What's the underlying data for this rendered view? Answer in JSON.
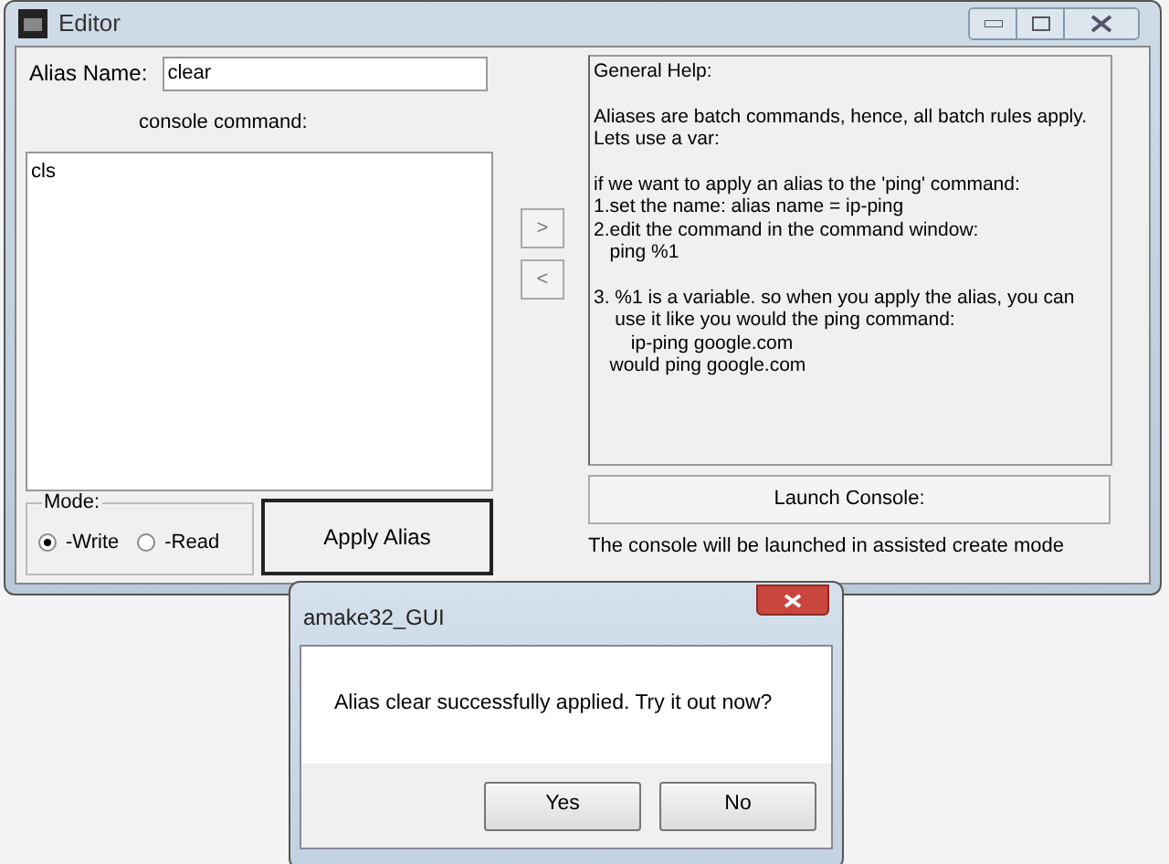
{
  "window": {
    "title": "Editor"
  },
  "alias_name": {
    "label": "Alias Name:",
    "value": "clear"
  },
  "console_command": {
    "label": "console command:",
    "value": "cls"
  },
  "arrow_buttons": [
    ">",
    "<"
  ],
  "mode": {
    "label": "Mode:",
    "options": [
      {
        "label": "-Write",
        "selected": true
      },
      {
        "label": "-Read",
        "selected": false
      }
    ]
  },
  "apply_button": "Apply Alias",
  "help": {
    "text": "General Help:\n\nAliases are batch commands, hence, all batch rules apply.\nLets use a var:\n\nif we want to apply an alias to the 'ping' command:\n1.set the name: alias name = ip-ping\n2.edit the command in the command window:\n   ping %1\n\n3. %1 is a variable. so when you apply the alias, you can\n    use it like you would the ping command:\n       ip-ping google.com\n   would ping google.com"
  },
  "launch_button": "Launch Console:",
  "status": "The console will be launched in assisted create mode",
  "dialog": {
    "title": "amake32_GUI",
    "message": "Alias clear successfully applied. Try it out now?",
    "buttons": [
      "Yes",
      "No"
    ]
  }
}
